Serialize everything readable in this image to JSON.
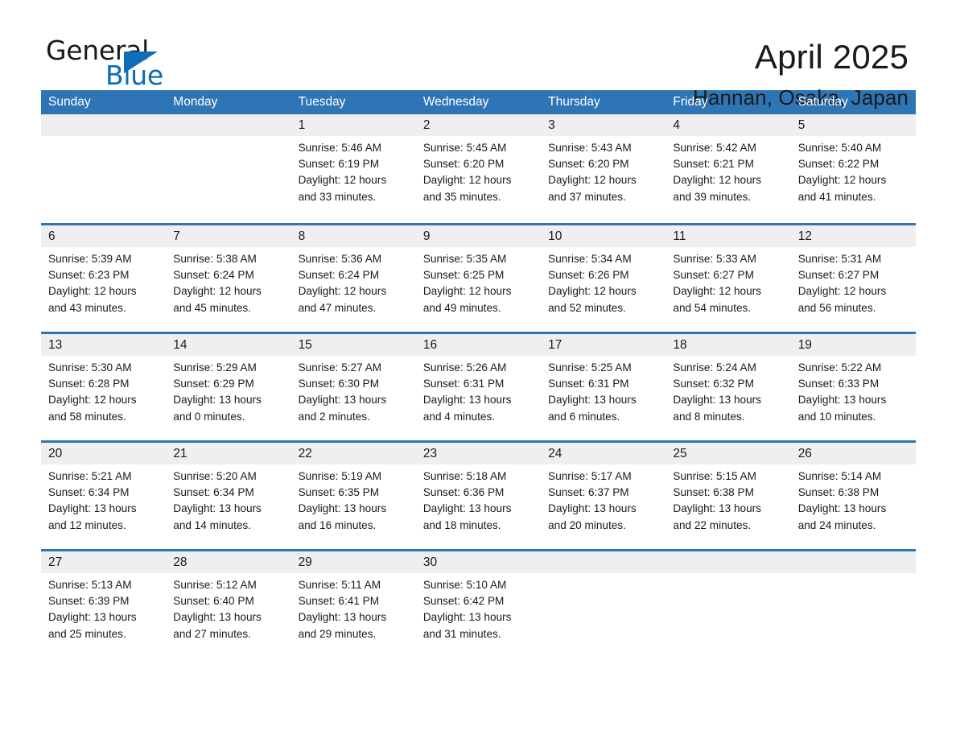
{
  "brand": {
    "name_part1": "General",
    "name_part2": "Blue",
    "triangle_icon": "triangle-icon",
    "accent_color": "#0d6fb8"
  },
  "header": {
    "month_title": "April 2025",
    "location": "Hannan, Osaka, Japan"
  },
  "theme": {
    "header_blue": "#2E75B6",
    "daynum_band": "#efefef",
    "text": "#1a1a1a"
  },
  "calendar": {
    "weekdays": [
      "Sunday",
      "Monday",
      "Tuesday",
      "Wednesday",
      "Thursday",
      "Friday",
      "Saturday"
    ],
    "weeks": [
      [
        {
          "day": "",
          "info": ""
        },
        {
          "day": "",
          "info": ""
        },
        {
          "day": "1",
          "info": "Sunrise: 5:46 AM\nSunset: 6:19 PM\nDaylight: 12 hours\nand 33 minutes."
        },
        {
          "day": "2",
          "info": "Sunrise: 5:45 AM\nSunset: 6:20 PM\nDaylight: 12 hours\nand 35 minutes."
        },
        {
          "day": "3",
          "info": "Sunrise: 5:43 AM\nSunset: 6:20 PM\nDaylight: 12 hours\nand 37 minutes."
        },
        {
          "day": "4",
          "info": "Sunrise: 5:42 AM\nSunset: 6:21 PM\nDaylight: 12 hours\nand 39 minutes."
        },
        {
          "day": "5",
          "info": "Sunrise: 5:40 AM\nSunset: 6:22 PM\nDaylight: 12 hours\nand 41 minutes."
        }
      ],
      [
        {
          "day": "6",
          "info": "Sunrise: 5:39 AM\nSunset: 6:23 PM\nDaylight: 12 hours\nand 43 minutes."
        },
        {
          "day": "7",
          "info": "Sunrise: 5:38 AM\nSunset: 6:24 PM\nDaylight: 12 hours\nand 45 minutes."
        },
        {
          "day": "8",
          "info": "Sunrise: 5:36 AM\nSunset: 6:24 PM\nDaylight: 12 hours\nand 47 minutes."
        },
        {
          "day": "9",
          "info": "Sunrise: 5:35 AM\nSunset: 6:25 PM\nDaylight: 12 hours\nand 49 minutes."
        },
        {
          "day": "10",
          "info": "Sunrise: 5:34 AM\nSunset: 6:26 PM\nDaylight: 12 hours\nand 52 minutes."
        },
        {
          "day": "11",
          "info": "Sunrise: 5:33 AM\nSunset: 6:27 PM\nDaylight: 12 hours\nand 54 minutes."
        },
        {
          "day": "12",
          "info": "Sunrise: 5:31 AM\nSunset: 6:27 PM\nDaylight: 12 hours\nand 56 minutes."
        }
      ],
      [
        {
          "day": "13",
          "info": "Sunrise: 5:30 AM\nSunset: 6:28 PM\nDaylight: 12 hours\nand 58 minutes."
        },
        {
          "day": "14",
          "info": "Sunrise: 5:29 AM\nSunset: 6:29 PM\nDaylight: 13 hours\nand 0 minutes."
        },
        {
          "day": "15",
          "info": "Sunrise: 5:27 AM\nSunset: 6:30 PM\nDaylight: 13 hours\nand 2 minutes."
        },
        {
          "day": "16",
          "info": "Sunrise: 5:26 AM\nSunset: 6:31 PM\nDaylight: 13 hours\nand 4 minutes."
        },
        {
          "day": "17",
          "info": "Sunrise: 5:25 AM\nSunset: 6:31 PM\nDaylight: 13 hours\nand 6 minutes."
        },
        {
          "day": "18",
          "info": "Sunrise: 5:24 AM\nSunset: 6:32 PM\nDaylight: 13 hours\nand 8 minutes."
        },
        {
          "day": "19",
          "info": "Sunrise: 5:22 AM\nSunset: 6:33 PM\nDaylight: 13 hours\nand 10 minutes."
        }
      ],
      [
        {
          "day": "20",
          "info": "Sunrise: 5:21 AM\nSunset: 6:34 PM\nDaylight: 13 hours\nand 12 minutes."
        },
        {
          "day": "21",
          "info": "Sunrise: 5:20 AM\nSunset: 6:34 PM\nDaylight: 13 hours\nand 14 minutes."
        },
        {
          "day": "22",
          "info": "Sunrise: 5:19 AM\nSunset: 6:35 PM\nDaylight: 13 hours\nand 16 minutes."
        },
        {
          "day": "23",
          "info": "Sunrise: 5:18 AM\nSunset: 6:36 PM\nDaylight: 13 hours\nand 18 minutes."
        },
        {
          "day": "24",
          "info": "Sunrise: 5:17 AM\nSunset: 6:37 PM\nDaylight: 13 hours\nand 20 minutes."
        },
        {
          "day": "25",
          "info": "Sunrise: 5:15 AM\nSunset: 6:38 PM\nDaylight: 13 hours\nand 22 minutes."
        },
        {
          "day": "26",
          "info": "Sunrise: 5:14 AM\nSunset: 6:38 PM\nDaylight: 13 hours\nand 24 minutes."
        }
      ],
      [
        {
          "day": "27",
          "info": "Sunrise: 5:13 AM\nSunset: 6:39 PM\nDaylight: 13 hours\nand 25 minutes."
        },
        {
          "day": "28",
          "info": "Sunrise: 5:12 AM\nSunset: 6:40 PM\nDaylight: 13 hours\nand 27 minutes."
        },
        {
          "day": "29",
          "info": "Sunrise: 5:11 AM\nSunset: 6:41 PM\nDaylight: 13 hours\nand 29 minutes."
        },
        {
          "day": "30",
          "info": "Sunrise: 5:10 AM\nSunset: 6:42 PM\nDaylight: 13 hours\nand 31 minutes."
        },
        {
          "day": "",
          "info": ""
        },
        {
          "day": "",
          "info": ""
        },
        {
          "day": "",
          "info": ""
        }
      ]
    ]
  }
}
